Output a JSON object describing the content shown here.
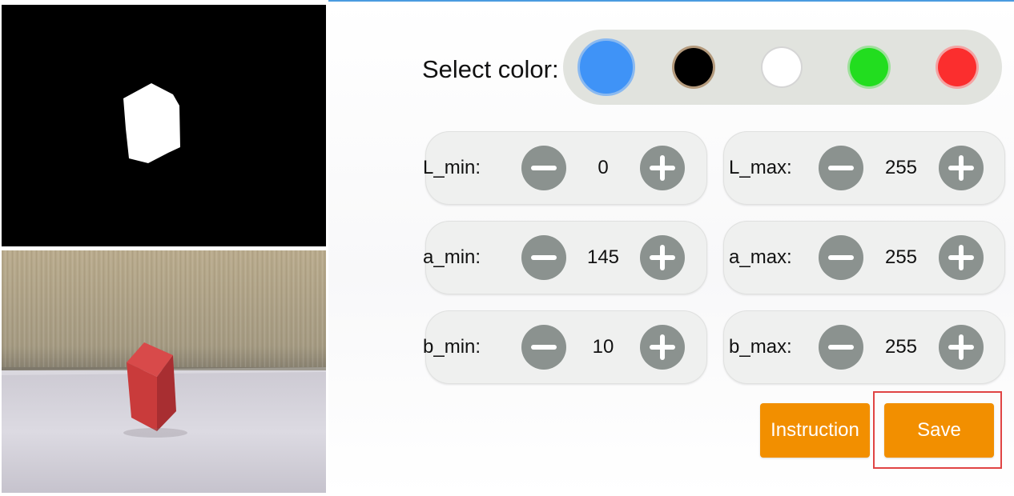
{
  "color_selector": {
    "label": "Select color:",
    "swatches": [
      {
        "name": "blue",
        "color": "#3f93f7",
        "selected": true
      },
      {
        "name": "black",
        "color": "#000000",
        "selected": false
      },
      {
        "name": "white",
        "color": "#ffffff",
        "selected": false
      },
      {
        "name": "green",
        "color": "#22dd1f",
        "selected": false
      },
      {
        "name": "red",
        "color": "#fb2e2e",
        "selected": false
      }
    ]
  },
  "thresholds": {
    "L_min": {
      "label": "L_min:",
      "value": "0"
    },
    "L_max": {
      "label": "L_max:",
      "value": "255"
    },
    "a_min": {
      "label": "a_min:",
      "value": "145"
    },
    "a_max": {
      "label": "a_max:",
      "value": "255"
    },
    "b_min": {
      "label": "b_min:",
      "value": "10"
    },
    "b_max": {
      "label": "b_max:",
      "value": "255"
    }
  },
  "actions": {
    "instruction_label": "Instruction",
    "save_label": "Save"
  },
  "colors": {
    "accent_orange": "#f28f00",
    "stepper_gray": "#8b928f",
    "highlight_red": "#e04444"
  }
}
